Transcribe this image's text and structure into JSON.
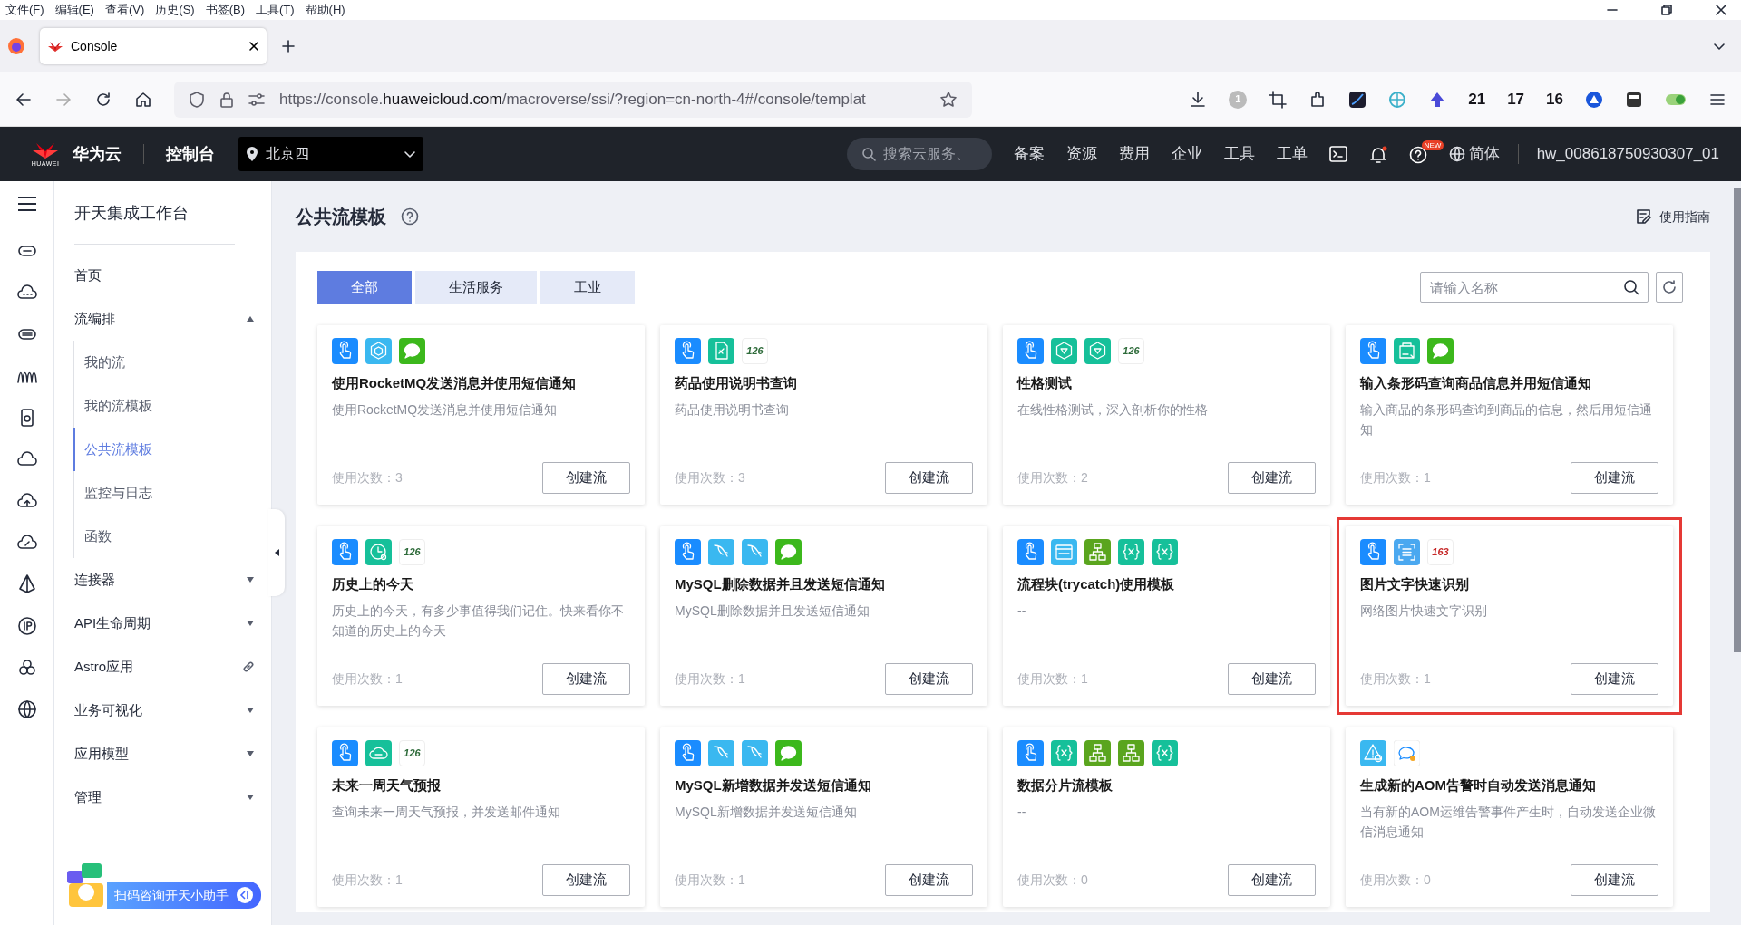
{
  "menu_bar": [
    "文件(F)",
    "编辑(E)",
    "查看(V)",
    "历史(S)",
    "书签(B)",
    "工具(T)",
    "帮助(H)"
  ],
  "browser_tabs": [
    {
      "title": "Console",
      "selected": true
    }
  ],
  "address_bar": {
    "url_start": "https://console.",
    "url_domain": "huaweicloud.com",
    "url_end": "/macroverse/ssi/?region=cn-north-4#/console/templat"
  },
  "toolbar_counts": [
    "1",
    "21",
    "17",
    "16"
  ],
  "header": {
    "logo_text": "HUAWEI",
    "brand": "华为云",
    "console": "控制台",
    "region": "北京四",
    "search_placeholder": "搜索云服务、",
    "nav": [
      "备案",
      "资源",
      "费用",
      "企业",
      "工具",
      "工单"
    ],
    "new_badge": "NEW",
    "language": "简体",
    "user": "hw_008618750930307_01"
  },
  "sidebar": {
    "title": "开天集成工作台",
    "items": [
      {
        "label": "首页",
        "kind": "link"
      },
      {
        "label": "流编排",
        "kind": "group",
        "expanded": true,
        "children": [
          {
            "label": "我的流",
            "selected": false
          },
          {
            "label": "我的流模板",
            "selected": false
          },
          {
            "label": "公共流模板",
            "selected": true
          },
          {
            "label": "监控与日志",
            "selected": false
          },
          {
            "label": "函数",
            "selected": false
          }
        ]
      },
      {
        "label": "连接器",
        "kind": "group",
        "expanded": false
      },
      {
        "label": "API生命周期",
        "kind": "group",
        "expanded": false
      },
      {
        "label": "Astro应用",
        "kind": "external"
      },
      {
        "label": "业务可视化",
        "kind": "group",
        "expanded": false
      },
      {
        "label": "应用模型",
        "kind": "group",
        "expanded": false
      },
      {
        "label": "管理",
        "kind": "group",
        "expanded": false
      }
    ]
  },
  "helper": {
    "label": "扫码咨询开天小助手"
  },
  "page": {
    "title": "公共流模板",
    "guide": "使用指南"
  },
  "filter_tabs": [
    {
      "label": "全部",
      "selected": true
    },
    {
      "label": "生活服务",
      "selected": false
    },
    {
      "label": "工业",
      "selected": false
    }
  ],
  "search": {
    "placeholder": "请输入名称"
  },
  "templates": [
    {
      "icons": [
        {
          "kind": "touch"
        },
        {
          "kind": "cube"
        },
        {
          "kind": "chat"
        }
      ],
      "title": "使用RocketMQ发送消息并使用短信通知",
      "description": "使用RocketMQ发送消息并使用短信通知",
      "usage": "使用次数：3",
      "button": "创建流",
      "highlighted": false
    },
    {
      "icons": [
        {
          "kind": "touch"
        },
        {
          "kind": "doc"
        },
        {
          "kind": "logo",
          "label": "126",
          "color": "#2e6b3a"
        }
      ],
      "title": "药品使用说明书查询",
      "description": "药品使用说明书查询",
      "usage": "使用次数：3",
      "button": "创建流",
      "highlighted": false
    },
    {
      "icons": [
        {
          "kind": "touch"
        },
        {
          "kind": "hex"
        },
        {
          "kind": "hex"
        },
        {
          "kind": "logo",
          "label": "126",
          "color": "#2e6b3a"
        }
      ],
      "title": "性格测试",
      "description": "在线性格测试，深入剖析你的性格",
      "usage": "使用次数：2",
      "button": "创建流",
      "highlighted": false
    },
    {
      "icons": [
        {
          "kind": "touch"
        },
        {
          "kind": "bag"
        },
        {
          "kind": "chat"
        }
      ],
      "title": "输入条形码查询商品信息并用短信通知",
      "description": "输入商品的条形码查询到商品的信息，然后用短信通知",
      "usage": "使用次数：1",
      "button": "创建流",
      "highlighted": false
    },
    {
      "icons": [
        {
          "kind": "touch"
        },
        {
          "kind": "clock"
        },
        {
          "kind": "logo",
          "label": "126",
          "color": "#2e6b3a"
        }
      ],
      "title": "历史上的今天",
      "description": "历史上的今天，有多少事值得我们记住。快来看你不知道的历史上的今天",
      "usage": "使用次数：1",
      "button": "创建流",
      "highlighted": false
    },
    {
      "icons": [
        {
          "kind": "touch"
        },
        {
          "kind": "dolphin"
        },
        {
          "kind": "dolphin"
        },
        {
          "kind": "chat"
        }
      ],
      "title": "MySQL删除数据并且发送短信通知",
      "description": "MySQL删除数据并且发送短信通知",
      "usage": "使用次数：1",
      "button": "创建流",
      "highlighted": false
    },
    {
      "icons": [
        {
          "kind": "touch"
        },
        {
          "kind": "window"
        },
        {
          "kind": "tree"
        },
        {
          "kind": "braces"
        },
        {
          "kind": "braces"
        }
      ],
      "title": "流程块(trycatch)使用模板",
      "description": "--",
      "usage": "使用次数：1",
      "button": "创建流",
      "highlighted": false
    },
    {
      "icons": [
        {
          "kind": "touch"
        },
        {
          "kind": "scan"
        },
        {
          "kind": "logo",
          "label": "163",
          "color": "#c62828"
        }
      ],
      "title": "图片文字快速识别",
      "description": "网络图片快速文字识别",
      "usage": "使用次数：1",
      "button": "创建流",
      "highlighted": true
    },
    {
      "icons": [
        {
          "kind": "touch"
        },
        {
          "kind": "cloud"
        },
        {
          "kind": "logo",
          "label": "126",
          "color": "#2e6b3a"
        }
      ],
      "title": "未来一周天气预报",
      "description": "查询未来一周天气预报，并发送邮件通知",
      "usage": "使用次数：1",
      "button": "创建流",
      "highlighted": false
    },
    {
      "icons": [
        {
          "kind": "touch"
        },
        {
          "kind": "dolphin"
        },
        {
          "kind": "dolphin"
        },
        {
          "kind": "chat"
        }
      ],
      "title": "MySQL新增数据并发送短信通知",
      "description": "MySQL新增数据并发送短信通知",
      "usage": "使用次数：1",
      "button": "创建流",
      "highlighted": false
    },
    {
      "icons": [
        {
          "kind": "touch"
        },
        {
          "kind": "braces"
        },
        {
          "kind": "tree"
        },
        {
          "kind": "tree"
        },
        {
          "kind": "braces"
        }
      ],
      "title": "数据分片流模板",
      "description": "--",
      "usage": "使用次数：0",
      "button": "创建流",
      "highlighted": false
    },
    {
      "icons": [
        {
          "kind": "alarm"
        },
        {
          "kind": "wechat"
        }
      ],
      "title": "生成新的AOM告警时自动发送消息通知",
      "description": "当有新的AOM运维告警事件产生时，自动发送企业微信消息通知",
      "usage": "使用次数：0",
      "button": "创建流",
      "highlighted": false
    }
  ]
}
